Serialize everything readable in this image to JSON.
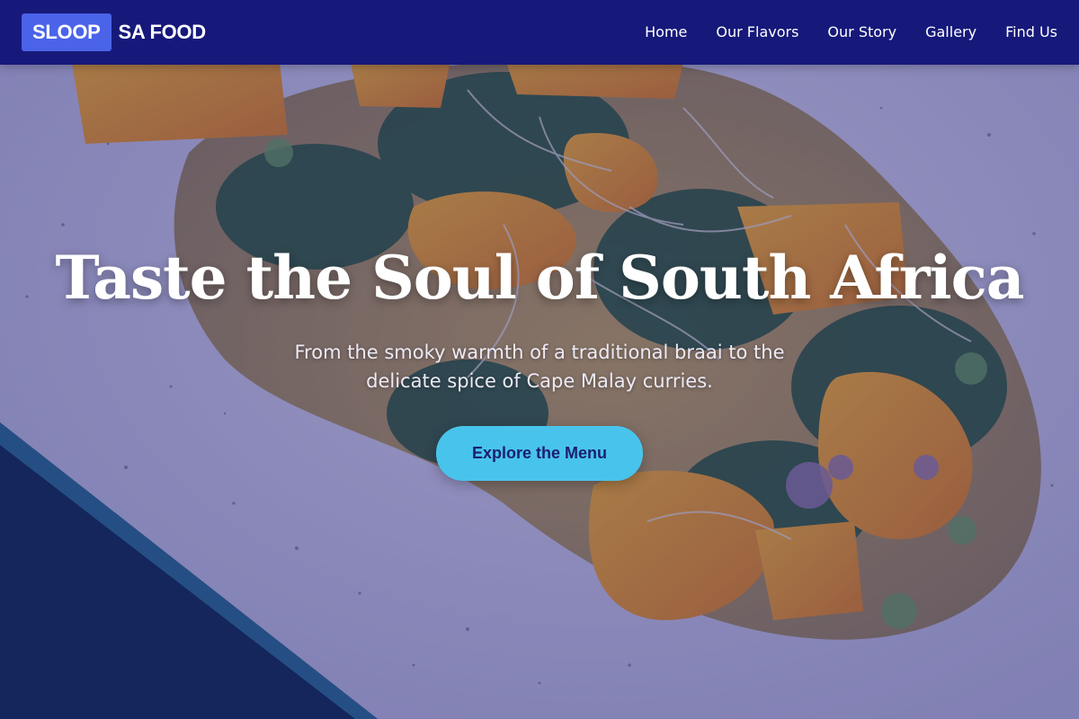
{
  "brand": {
    "badge": "SLOOP",
    "text": "SA FOOD"
  },
  "nav": {
    "items": [
      {
        "label": "Home"
      },
      {
        "label": "Our Flavors"
      },
      {
        "label": "Our Story"
      },
      {
        "label": "Gallery"
      },
      {
        "label": "Find Us"
      }
    ]
  },
  "hero": {
    "title": "Taste the Soul of South Africa",
    "subtitle": "From the smoky warmth of a traditional braai to the delicate spice of Cape Malay curries.",
    "cta_label": "Explore the Menu",
    "background_image": "plated-dish-photo"
  },
  "colors": {
    "navbar": "#16197a",
    "brand_badge": "#4b63e8",
    "cta_background": "#48c4ec",
    "cta_text": "#1b1f6e"
  }
}
